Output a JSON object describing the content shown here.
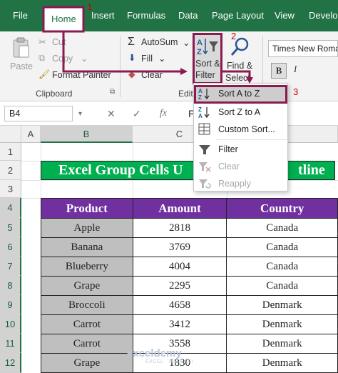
{
  "tabs": {
    "file": "File",
    "home": "Home",
    "insert": "Insert",
    "formulas": "Formulas",
    "data": "Data",
    "page_layout": "Page Layout",
    "view": "View",
    "developer": "Develop"
  },
  "steps": {
    "one": "1",
    "two": "2",
    "three": "3"
  },
  "ribbon": {
    "paste": "Paste",
    "cut": "Cut",
    "copy": "Copy",
    "format_painter": "Format Painter",
    "clipboard": "Clipboard",
    "autosum": "AutoSum",
    "fill": "Fill",
    "clear": "Clear",
    "editing": "Editi",
    "sort_filter_line1": "Sort &",
    "sort_filter_line2": "Filter",
    "find_select_line1": "Find &",
    "find_select_line2": "Select",
    "font_name": "Times New Roma",
    "bold": "B",
    "italic": "I"
  },
  "formula_bar": {
    "name_box": "B4",
    "fx": "fx",
    "cancel": "✕",
    "enter": "✓",
    "content": "P"
  },
  "columns": [
    "A",
    "B",
    "C"
  ],
  "rows": [
    "1",
    "2",
    "3",
    "4",
    "5",
    "6",
    "7",
    "8",
    "9",
    "10",
    "11",
    "12"
  ],
  "sheet": {
    "title": "Excel Group Cells U",
    "title_tail": "tline",
    "headers": [
      "Product",
      "Amount",
      "Country"
    ],
    "data": [
      [
        "Apple",
        "2818",
        "Canada"
      ],
      [
        "Banana",
        "3769",
        "Canada"
      ],
      [
        "Blueberry",
        "4004",
        "Canada"
      ],
      [
        "Grape",
        "2295",
        "Canada"
      ],
      [
        "Broccoli",
        "4658",
        "Denmark"
      ],
      [
        "Carrot",
        "3412",
        "Denmark"
      ],
      [
        "Carrot",
        "3558",
        "Denmark"
      ],
      [
        "Grape",
        "1830",
        "Denmark"
      ]
    ]
  },
  "menu": {
    "sort_az": "Sort A to Z",
    "sort_za": "Sort Z to A",
    "custom_sort": "Custom Sort...",
    "filter": "Filter",
    "clear": "Clear",
    "reapply": "Reapply"
  },
  "watermark": {
    "name": "exceldemy",
    "tagline": "EXCEL · DATA · BI"
  },
  "colors": {
    "excel_green": "#217346",
    "title_green": "#00b050",
    "header_purple": "#7030a0",
    "highlight_border": "#8b1a50",
    "step_red": "#d10000"
  }
}
